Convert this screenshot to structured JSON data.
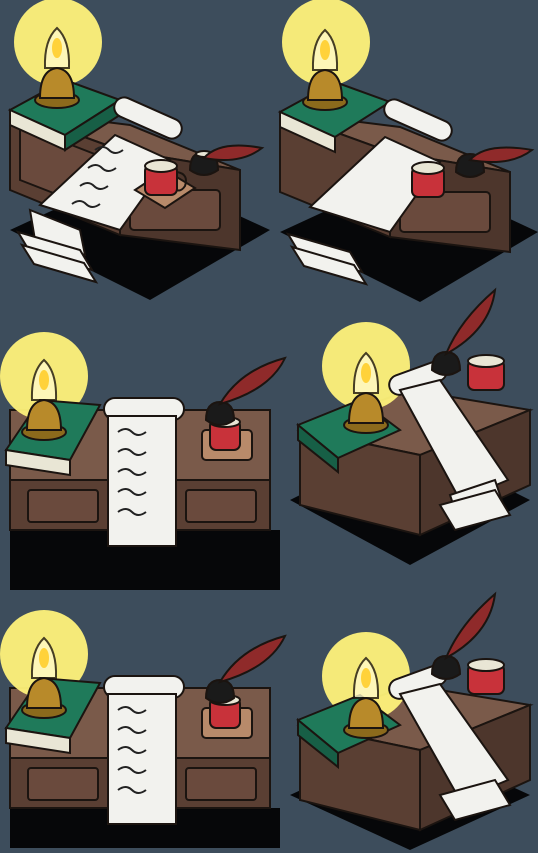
{
  "sprite_sheet": {
    "background": "#3d4d5c",
    "colors": {
      "outline": "#1b1410",
      "desk_top": "#7a5a4a",
      "desk_front": "#5a3f33",
      "desk_shadow": "#000000",
      "book_green": "#1f7a5a",
      "book_pages": "#e9e6d5",
      "scroll_paper": "#f2f2ee",
      "brass": "#b88a2a",
      "lamp_glow": "#fff27a",
      "flame": "#ffd23a",
      "cup_red": "#c8323a",
      "quill_red": "#8f2a2a",
      "ink_black": "#1a1a1a"
    },
    "sprites": [
      {
        "id": "desk-iso-right",
        "view": "isometric-right",
        "icons": [
          "lamp-icon",
          "book-icon",
          "scroll-icon",
          "quill-icon",
          "inkwell-icon",
          "cup-icon",
          "papers-icon"
        ]
      },
      {
        "id": "desk-iso-right-b",
        "view": "isometric-right",
        "icons": [
          "lamp-icon",
          "book-icon",
          "scroll-icon",
          "quill-icon",
          "inkwell-icon",
          "cup-icon",
          "papers-icon"
        ]
      },
      {
        "id": "desk-front",
        "view": "front",
        "icons": [
          "lamp-icon",
          "book-icon",
          "scroll-icon",
          "quill-icon",
          "inkwell-icon",
          "cup-icon"
        ]
      },
      {
        "id": "desk-iso-left",
        "view": "isometric-left",
        "icons": [
          "lamp-icon",
          "book-icon",
          "scroll-icon",
          "quill-icon",
          "inkwell-icon",
          "cup-icon",
          "papers-icon"
        ]
      },
      {
        "id": "desk-front-b",
        "view": "front",
        "icons": [
          "lamp-icon",
          "book-icon",
          "scroll-icon",
          "quill-icon",
          "inkwell-icon",
          "cup-icon"
        ]
      },
      {
        "id": "desk-iso-left-b",
        "view": "isometric-left",
        "icons": [
          "lamp-icon",
          "book-icon",
          "scroll-icon",
          "quill-icon",
          "inkwell-icon",
          "cup-icon",
          "papers-icon"
        ]
      }
    ]
  }
}
